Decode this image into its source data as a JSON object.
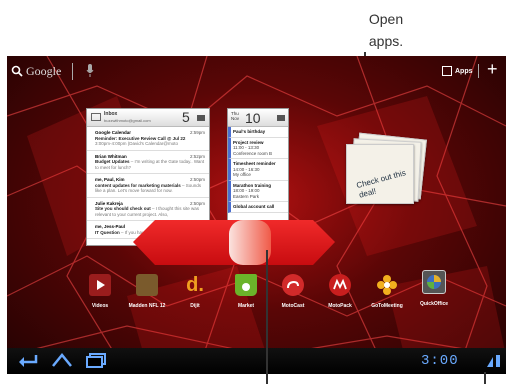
{
  "callouts": {
    "open_apps_line1": "Open",
    "open_apps_line2": "apps."
  },
  "topbar": {
    "search_label": "Google",
    "apps_label": "Apps",
    "add_label": "+"
  },
  "gmail_widget": {
    "folder": "Inbox",
    "account": "buzzwithmoto@gmail.com",
    "unread_count": "5",
    "messages": [
      {
        "from": "Google Calendar",
        "time": "2:59pm",
        "subject": "Reminder: Executive Review Call @ Jul 22",
        "snippet": "3:00pm-4:00pm (David's Calendar@moto"
      },
      {
        "from": "Brian Whitman",
        "time": "2:52pm",
        "subject": "Budget Updates",
        "snippet": "– I'm writing at the Gate today.. Want to meet for lunch?"
      },
      {
        "from": "me, Paul, Kim",
        "time": "2:50pm",
        "subject": "content updates for marketing materials",
        "snippet": "– Sounds like a plan. Let's move forward for now."
      },
      {
        "from": "Julie Kakreja",
        "time": "2:50pm",
        "subject": "Site you should check out",
        "snippet": "– I thought this site was relevant to your current project. Also,"
      },
      {
        "from": "me, Jess-Paul",
        "time": "2:50pm",
        "subject": "IT Question",
        "snippet": "– If you have the time today,"
      }
    ]
  },
  "calendar_widget": {
    "day_short": "Thu",
    "month_short": "Nov",
    "date": "10",
    "events": [
      {
        "title": "Paul's birthday",
        "time": "",
        "location": ""
      },
      {
        "title": "Project review",
        "time": "11:00 - 13:30",
        "location": "Conference room B"
      },
      {
        "title": "Timesheet reminder",
        "time": "14:00 - 16:30",
        "location": "My office"
      },
      {
        "title": "Marathon training",
        "time": "18:00 - 19:00",
        "location": "Eastern Park"
      },
      {
        "title": "Global account call",
        "time": "",
        "location": ""
      }
    ]
  },
  "deal_widget": {
    "text": "Check out this deal!"
  },
  "apps": [
    {
      "label": "Videos",
      "color": "#9a1d1d"
    },
    {
      "label": "Madden NFL 12",
      "color": "#7a5a2c"
    },
    {
      "label": "Dijit",
      "color": "#d68a1a"
    },
    {
      "label": "Market",
      "color": "#6bb42a"
    },
    {
      "label": "MotoCast",
      "color": "#d22a2a"
    },
    {
      "label": "MotoPack",
      "color": "#c81e1e"
    },
    {
      "label": "GoToMeeting",
      "color": "#f2b01e"
    },
    {
      "label": "QuickOffice",
      "color": "#3d6fc0"
    }
  ],
  "statusbar": {
    "clock": "3:00"
  },
  "colors": {
    "accent": "#4a9cff",
    "scrubber": "#e0161a"
  }
}
